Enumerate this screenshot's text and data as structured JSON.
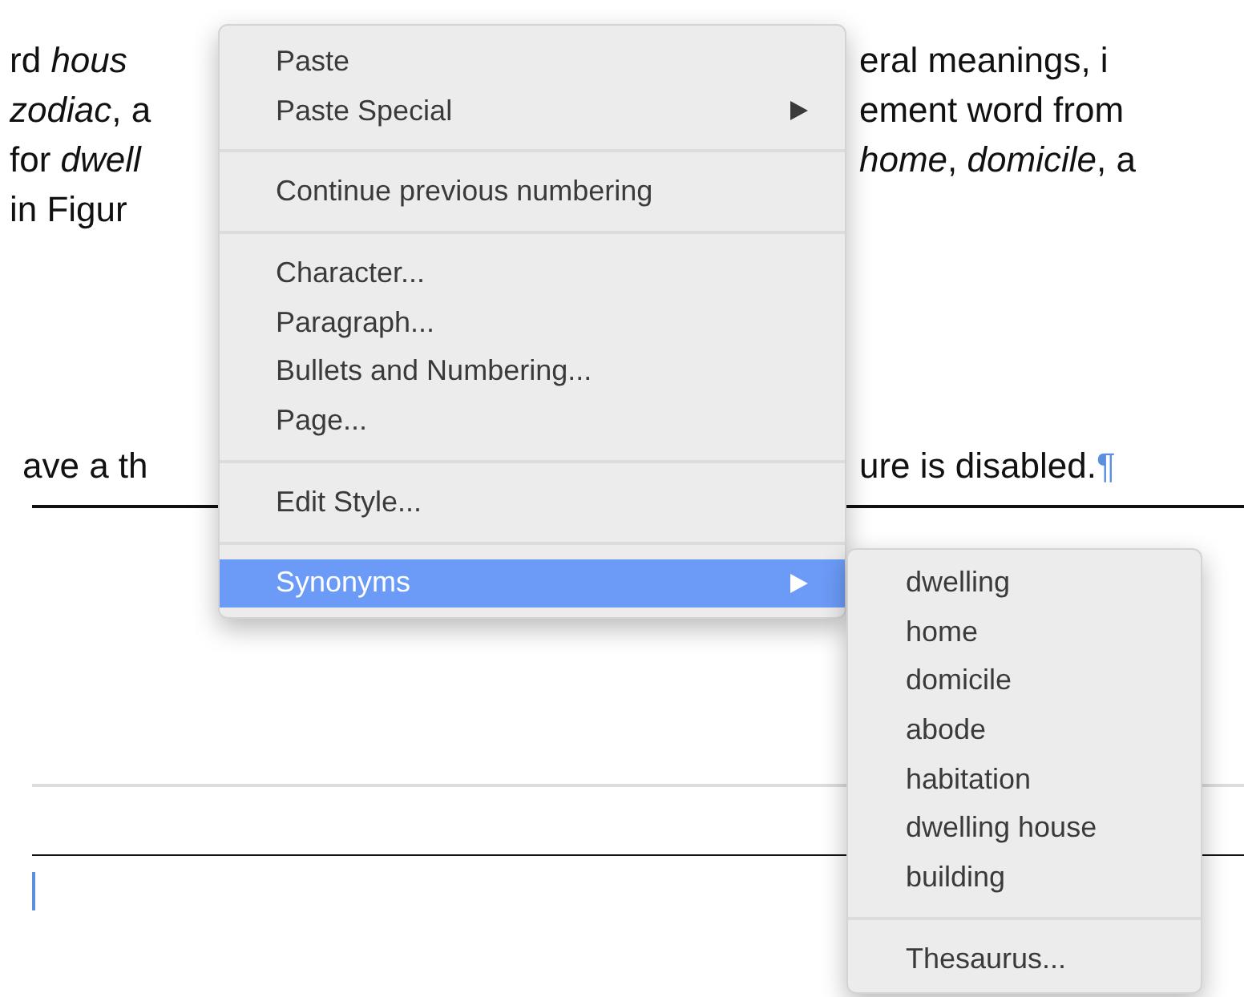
{
  "document": {
    "lines": [
      {
        "left": "rd *hous*",
        "right": "eral meanings, i"
      },
      {
        "left": "*zodiac*, a",
        "right": "ement word from"
      },
      {
        "left": "for *dwell*",
        "right": "*home*, *domicile*, a"
      },
      {
        "left": "in Figur"
      },
      {
        "left": "ave a th",
        "right": "ure is disabled.",
        "pilcrow": "¶"
      }
    ]
  },
  "context_menu": {
    "items": [
      {
        "kind": "item",
        "label": "Paste",
        "selected": false
      },
      {
        "kind": "submenu",
        "label": "Paste Special",
        "selected": false
      },
      {
        "kind": "separator"
      },
      {
        "kind": "item",
        "label": "Continue previous numbering",
        "selected": false
      },
      {
        "kind": "separator"
      },
      {
        "kind": "item",
        "label": "Character...",
        "selected": false
      },
      {
        "kind": "item",
        "label": "Paragraph...",
        "selected": false
      },
      {
        "kind": "item",
        "label": "Bullets and Numbering...",
        "selected": false
      },
      {
        "kind": "item",
        "label": "Page...",
        "selected": false
      },
      {
        "kind": "separator"
      },
      {
        "kind": "item",
        "label": "Edit Style...",
        "selected": false
      },
      {
        "kind": "separator"
      },
      {
        "kind": "submenu",
        "label": "Synonyms",
        "selected": true
      }
    ]
  },
  "synonyms_menu": {
    "items": [
      {
        "kind": "item",
        "label": "dwelling",
        "selected": false
      },
      {
        "kind": "item",
        "label": "home",
        "selected": false
      },
      {
        "kind": "item",
        "label": "domicile",
        "selected": false
      },
      {
        "kind": "item",
        "label": "abode",
        "selected": false
      },
      {
        "kind": "item",
        "label": "habitation",
        "selected": false
      },
      {
        "kind": "item",
        "label": "dwelling house",
        "selected": false
      },
      {
        "kind": "item",
        "label": "building",
        "selected": false
      },
      {
        "kind": "separator"
      },
      {
        "kind": "item",
        "label": "Thesaurus...",
        "selected": false
      }
    ]
  }
}
